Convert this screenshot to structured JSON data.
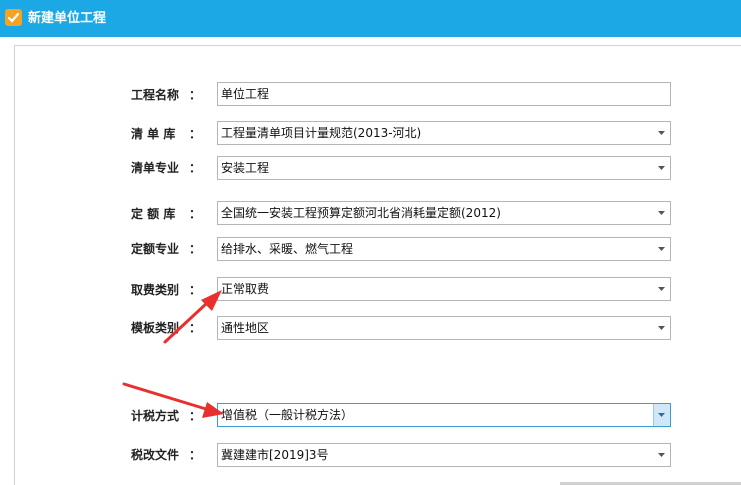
{
  "window": {
    "title": "新建单位工程"
  },
  "form": {
    "project_name": {
      "label": "工程名称",
      "colon": "：",
      "value": "单位工程"
    },
    "bill_library": {
      "label": "清 单 库",
      "colon": "：",
      "value": "工程量清单项目计量规范(2013-河北)"
    },
    "bill_specialty": {
      "label": "清单专业",
      "colon": "：",
      "value": "安装工程"
    },
    "quota_library": {
      "label": "定 额 库",
      "colon": "：",
      "value": "全国统一安装工程预算定额河北省消耗量定额(2012)"
    },
    "quota_specialty": {
      "label": "定额专业",
      "colon": "：",
      "value": "给排水、采暖、燃气工程"
    },
    "fee_category": {
      "label": "取费类别",
      "colon": "：",
      "value": "正常取费"
    },
    "template_category": {
      "label": "模板类别",
      "colon": "：",
      "value": "通性地区"
    },
    "tax_method": {
      "label": "计税方式",
      "colon": "：",
      "value": "增值税（一般计税方法）"
    },
    "tax_document": {
      "label": "税改文件",
      "colon": "：",
      "value": "冀建建市[2019]3号"
    }
  },
  "colors": {
    "titlebar": "#1ba8e5",
    "annotation_arrow": "#e8312f"
  }
}
